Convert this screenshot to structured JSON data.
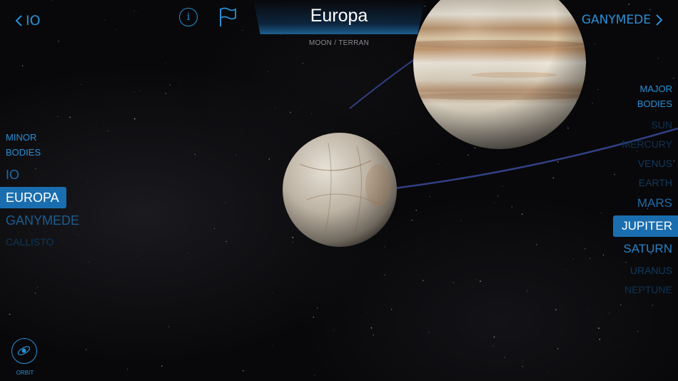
{
  "header": {
    "prev_label": "IO",
    "next_label": "GANYMEDE",
    "title": "Europa",
    "subtitle": "MOON / TERRAN"
  },
  "minor_bodies": {
    "heading_line1": "MINOR",
    "heading_line2": "BODIES",
    "items": [
      {
        "label": "IO",
        "color": "#1f6aa6"
      },
      {
        "label": "EUROPA",
        "color": "#ffffff"
      },
      {
        "label": "GANYMEDE",
        "color": "#1c5c90"
      },
      {
        "label": "CALLISTO",
        "color": "#103556"
      }
    ]
  },
  "major_bodies": {
    "heading_line1": "MAJOR",
    "heading_line2": "BODIES",
    "items": [
      {
        "label": "SUN",
        "color": "#0f3252"
      },
      {
        "label": "MERCURY",
        "color": "#0f3252"
      },
      {
        "label": "VENUS",
        "color": "#123a5e"
      },
      {
        "label": "EARTH",
        "color": "#123a5e"
      },
      {
        "label": "MARS",
        "color": "#1f6aa6"
      },
      {
        "label": "JUPITER",
        "color": "#ffffff"
      },
      {
        "label": "SATURN",
        "color": "#2a80c4"
      },
      {
        "label": "URANUS",
        "color": "#123a5e"
      },
      {
        "label": "NEPTUNE",
        "color": "#0f3252"
      }
    ]
  },
  "orbit": {
    "label": "ORBIT"
  },
  "icons": {
    "back": "chevron-left-icon",
    "forward": "chevron-right-icon",
    "info": "info-icon",
    "flag": "flag-icon",
    "orbit": "orbit-icon"
  },
  "colors": {
    "accent": "#2a8fd6",
    "selected_bg": "#1a6eb0",
    "background": "#08080a"
  }
}
